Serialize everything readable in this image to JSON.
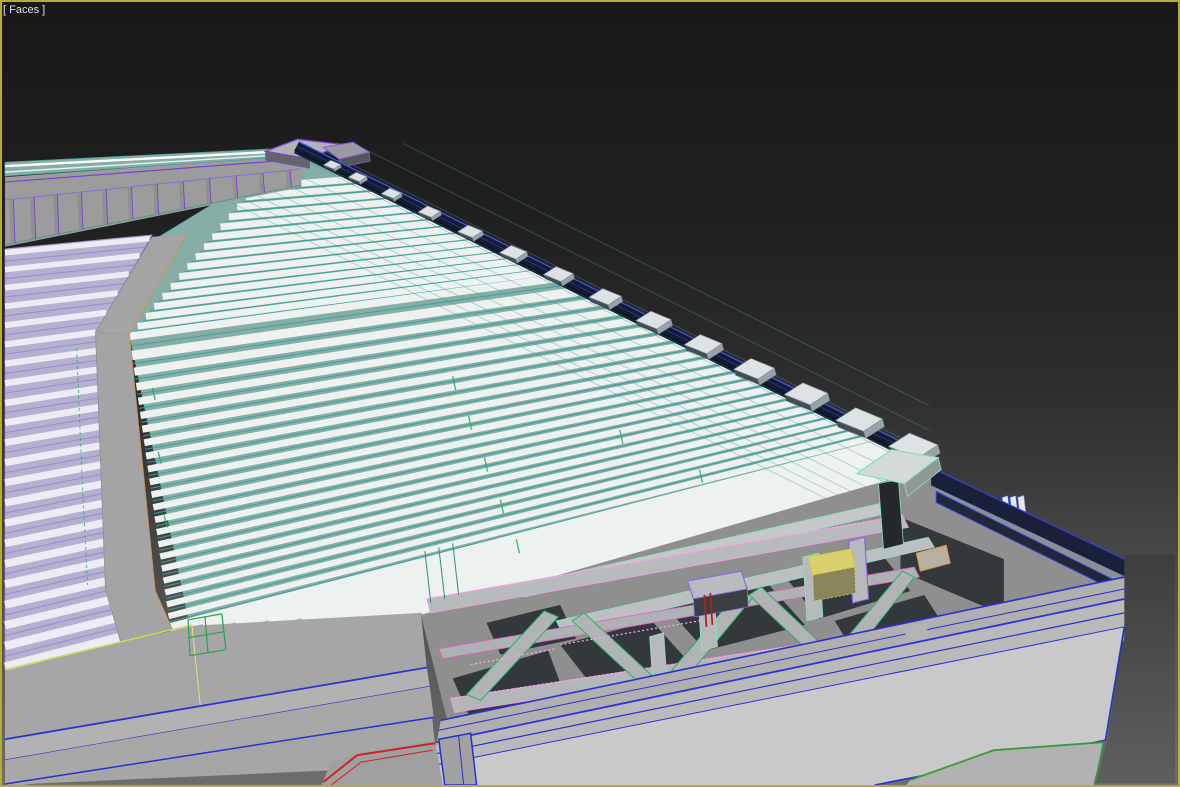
{
  "viewport": {
    "label": "[ Faces ]",
    "border_color": "#b9ab2c",
    "bg_top": "#181818",
    "bg_mid": "#2e2e2e",
    "bg_bottom": "#6d6d6d",
    "label_color": "#e2e2e2"
  },
  "palette": {
    "model_grey": "#a8a8a8",
    "slat_white": "#edf1f0",
    "teal_base": "#86aea7",
    "teal_wire": "#3aa0a0",
    "teal_dark": "#2e8e80",
    "lavender_base": "#b4b0d0",
    "lavender_wire": "#988dd0",
    "lavender_white": "#edecf5",
    "purple_wire": "#7a44d0",
    "navy_fill": "#141c30",
    "blue_wire": "#2830d0",
    "blue_bright": "#4456ee",
    "green_wire": "#2fae60",
    "yellow_green": "#cbdf4e",
    "pink_wire": "#f09cdc",
    "pink_dotted": "#ffa2ea",
    "magenta_wire": "#e060c0",
    "yellow_wire": "#d8d040",
    "orange_wire": "#e0953f",
    "mint_wire": "#85e0c4",
    "red_wire": "#cc2222",
    "dark_green_wire": "#3a9a3a",
    "tan_wire": "#c8935a",
    "shadow_dark": "#33383d",
    "beam_grey": "#b5b8ba",
    "wall_grey": "#c9c9c9"
  },
  "model": {
    "main_roof_slats": 50,
    "left_roof_slats": 22,
    "eave_brackets": 14,
    "fence_posts": 12
  }
}
